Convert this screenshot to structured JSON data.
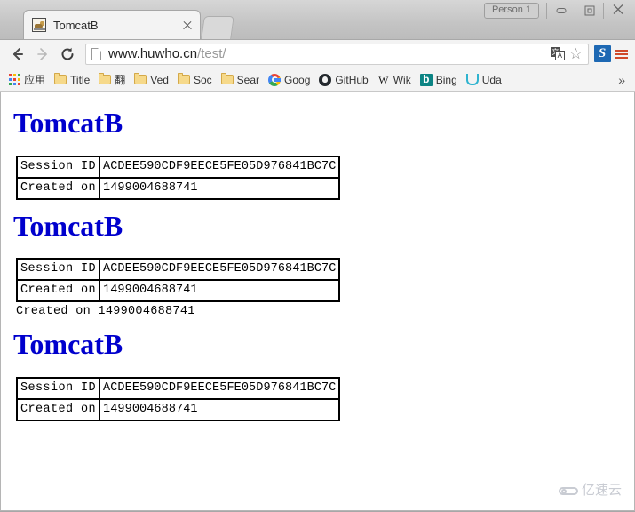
{
  "window": {
    "profile_button": "Person 1",
    "minimize_label": "Minimize",
    "maximize_label": "Maximize",
    "close_label": "Close"
  },
  "tab": {
    "title": "TomcatB",
    "favicon": "tomcat-cat-icon",
    "close_label": "×",
    "new_tab_label": "New tab"
  },
  "toolbar": {
    "back_label": "Back",
    "forward_label": "Forward",
    "reload_label": "Reload",
    "url_host": "www.huwho.cn",
    "url_path": "/test/",
    "url_full": "www.huwho.cn/test/",
    "translate_icon_primary": "文",
    "translate_icon_secondary": "A",
    "star_glyph": "☆",
    "extension_letter": "S",
    "menu_label": "Customize and control"
  },
  "bookmarks": {
    "apps_label": "应用",
    "items": [
      {
        "label": "Title",
        "icon": "folder-icon"
      },
      {
        "label": "翻",
        "icon": "folder-icon"
      },
      {
        "label": "Ved",
        "icon": "folder-icon"
      },
      {
        "label": "Soc",
        "icon": "folder-icon"
      },
      {
        "label": "Sear",
        "icon": "folder-icon"
      },
      {
        "label": "Goog",
        "icon": "google-icon"
      },
      {
        "label": "GitHub",
        "icon": "github-icon"
      },
      {
        "label": "Wik",
        "icon": "wikipedia-icon"
      },
      {
        "label": "Bing",
        "icon": "bing-icon"
      },
      {
        "label": "Uda",
        "icon": "udacity-icon"
      }
    ],
    "overflow_glyph": "»"
  },
  "page": {
    "blocks": [
      {
        "heading": "TomcatB",
        "rows": [
          {
            "label": "Session ID",
            "value": "ACDEE590CDF9EECE5FE05D976841BC7C"
          },
          {
            "label": "Created on",
            "value": "1499004688741"
          }
        ],
        "extra_line": ""
      },
      {
        "heading": "TomcatB",
        "rows": [
          {
            "label": "Session ID",
            "value": "ACDEE590CDF9EECE5FE05D976841BC7C"
          },
          {
            "label": "Created on",
            "value": "1499004688741"
          }
        ],
        "extra_line": "Created on 1499004688741"
      },
      {
        "heading": "TomcatB",
        "rows": [
          {
            "label": "Session ID",
            "value": "ACDEE590CDF9EECE5FE05D976841BC7C"
          },
          {
            "label": "Created on",
            "value": "1499004688741"
          }
        ],
        "extra_line": ""
      }
    ],
    "heading_color": "#0000cd"
  },
  "watermark": {
    "text": "亿速云",
    "icon": "cloud-icon",
    "color": "#c9ccd3"
  }
}
